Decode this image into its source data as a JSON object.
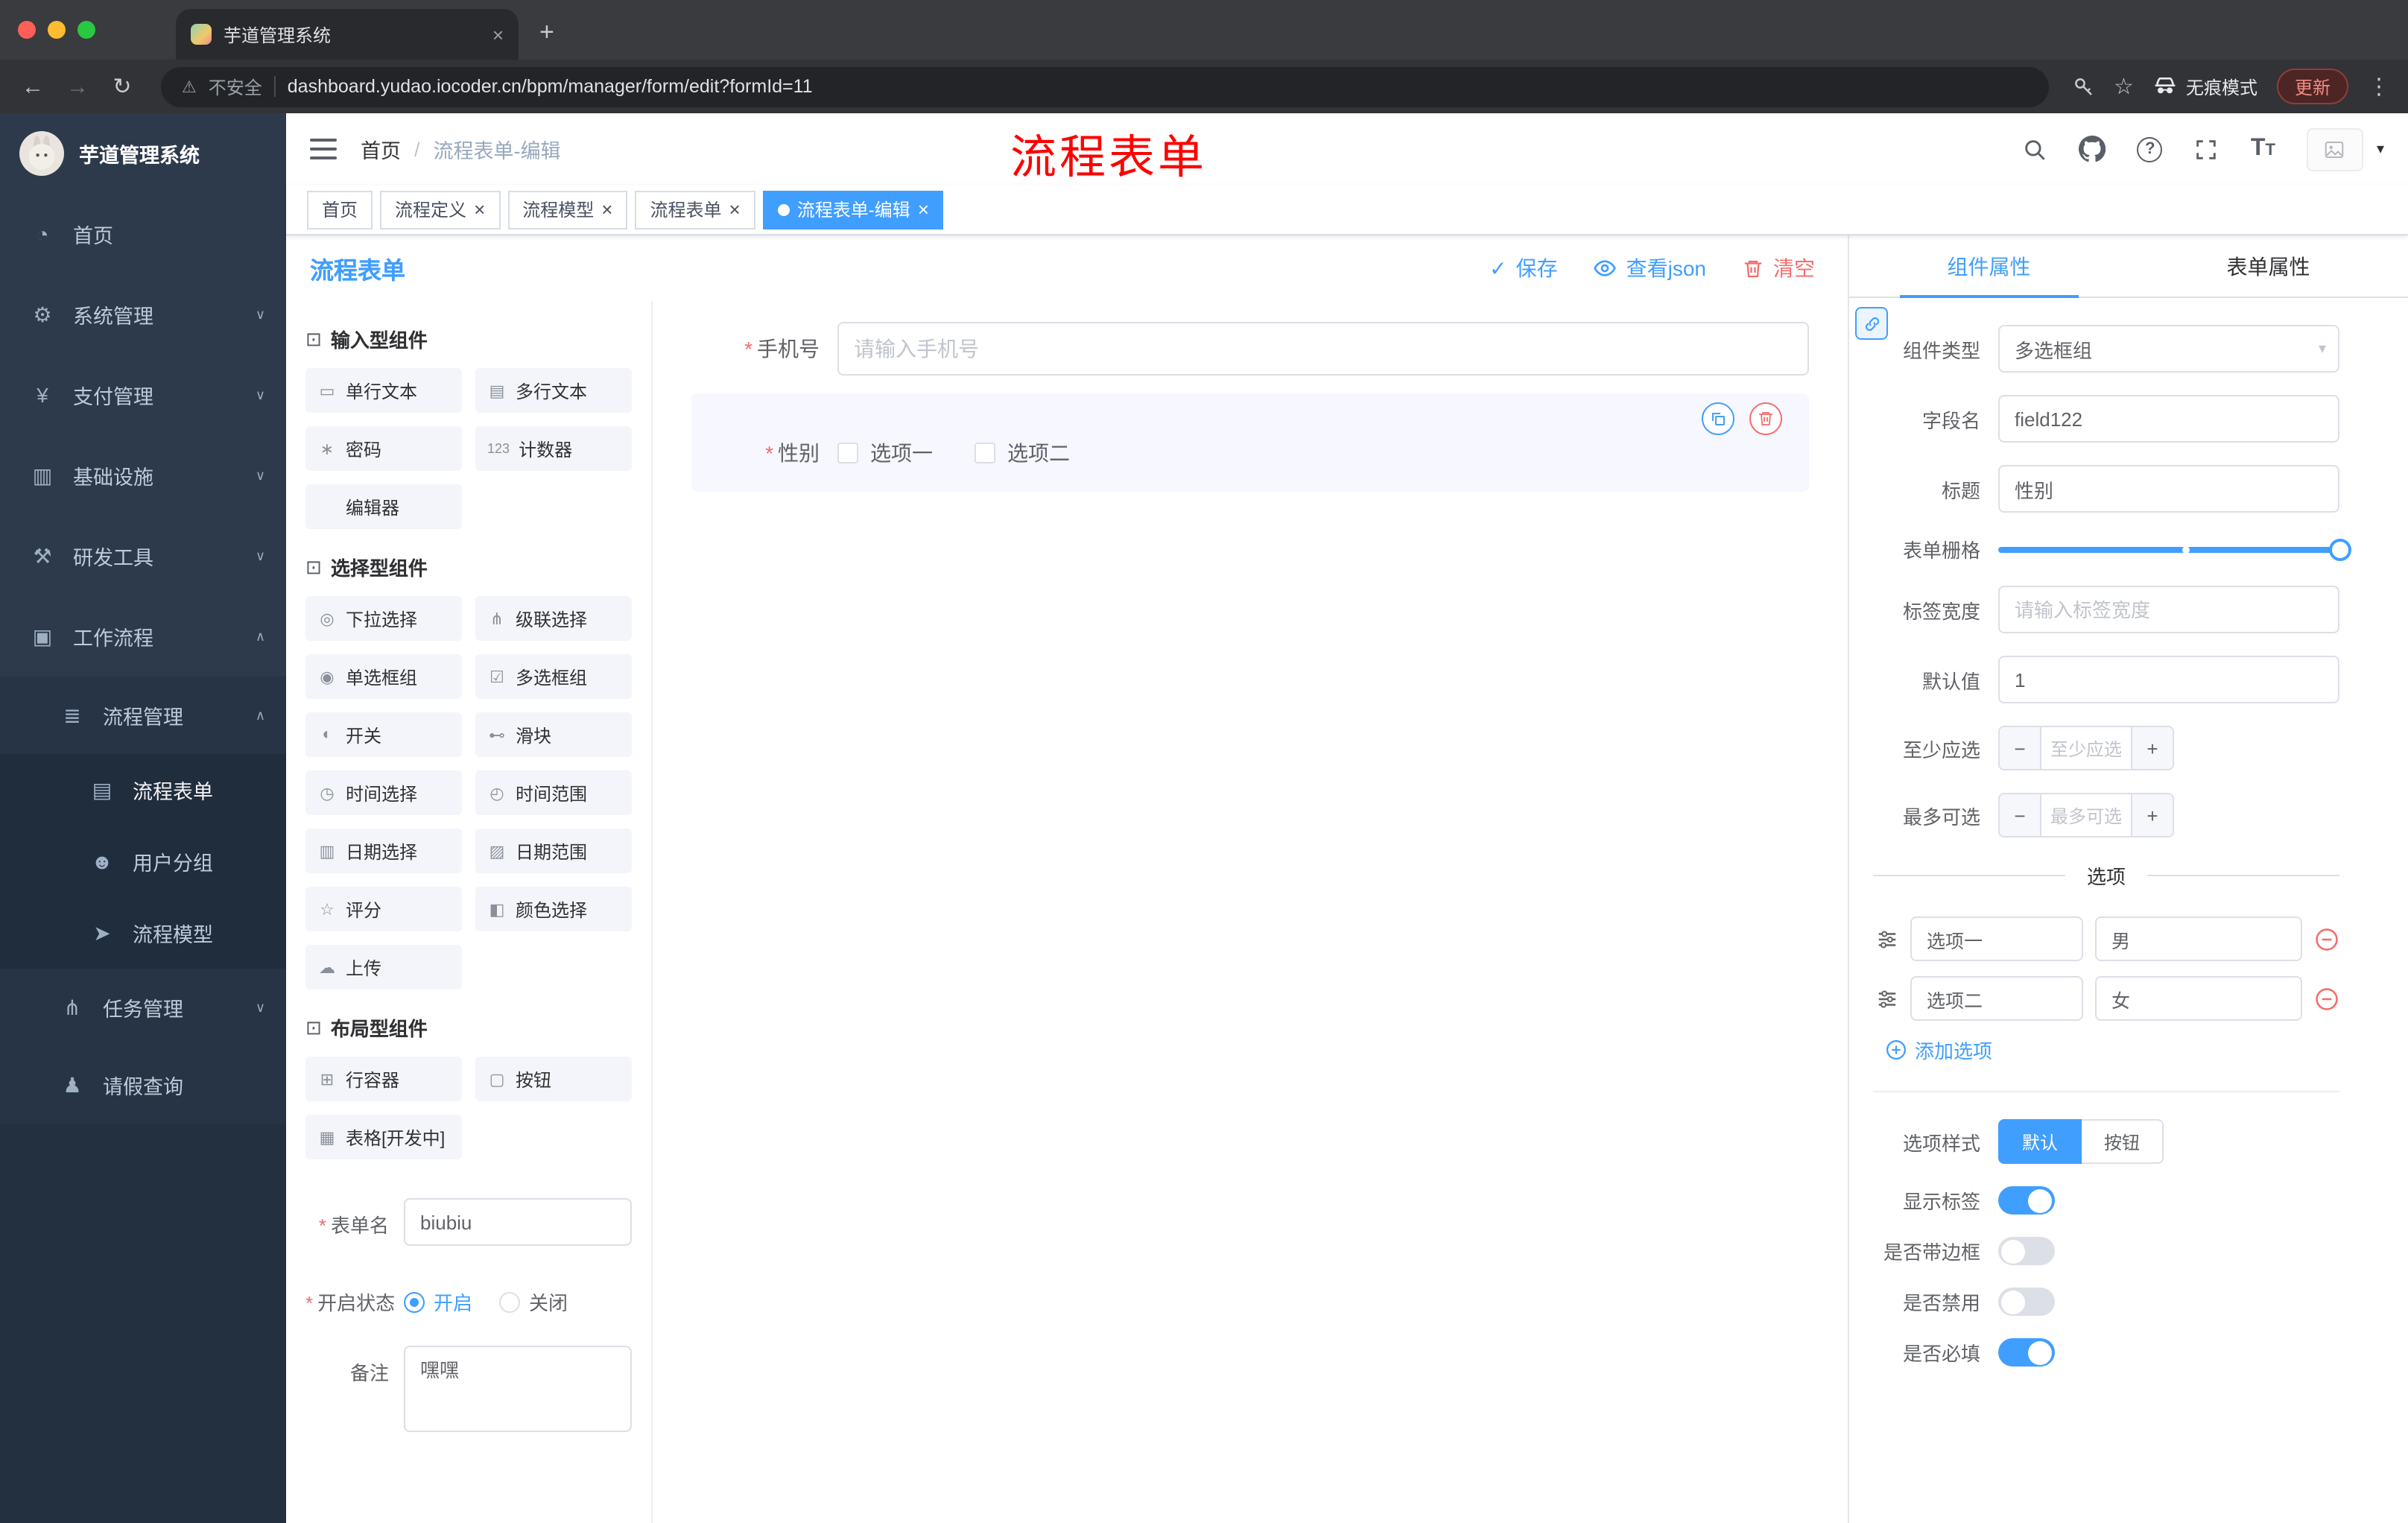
{
  "colors": {
    "primary": "#409eff",
    "danger": "#f56c6c",
    "sidebar_bg": "#2d3a4b",
    "active_tag": "#409eff",
    "annotation": "#ff0000"
  },
  "browser": {
    "tab_title": "芋道管理系统",
    "security": "不安全",
    "url": "dashboard.yudao.iocoder.cn/bpm/manager/form/edit?formId=11",
    "incognito": "无痕模式",
    "update": "更新",
    "glyphs": {
      "close": "×",
      "new_tab": "+",
      "back": "←",
      "forward": "→",
      "reload": "↻",
      "warn": "⚠",
      "star": "☆",
      "kebab": "⋮"
    }
  },
  "sidebar": {
    "app_title": "芋道管理系统",
    "items": [
      {
        "label": "首页",
        "icon": "◔",
        "arrow": ""
      },
      {
        "label": "系统管理",
        "icon": "⚙",
        "arrow": "∨"
      },
      {
        "label": "支付管理",
        "icon": "¥",
        "arrow": "∨"
      },
      {
        "label": "基础设施",
        "icon": "▥",
        "arrow": "∨"
      },
      {
        "label": "研发工具",
        "icon": "⚒",
        "arrow": "∨"
      },
      {
        "label": "工作流程",
        "icon": "▣",
        "arrow": "∧"
      },
      {
        "label": "流程管理",
        "icon": "≣",
        "arrow": "∧"
      },
      {
        "label": "流程表单",
        "icon": "▤",
        "arrow": ""
      },
      {
        "label": "用户分组",
        "icon": "☻",
        "arrow": ""
      },
      {
        "label": "流程模型",
        "icon": "➤",
        "arrow": ""
      },
      {
        "label": "任务管理",
        "icon": "⋔",
        "arrow": "∨"
      },
      {
        "label": "请假查询",
        "icon": "♟",
        "arrow": ""
      }
    ]
  },
  "header": {
    "breadcrumb_home": "首页",
    "breadcrumb_separator": "/",
    "breadcrumb_current": "流程表单-编辑",
    "annotation": "流程表单",
    "question_glyph": "?",
    "font_glyph": "T",
    "avatar_caret": "▾"
  },
  "tags": [
    {
      "label": "首页"
    },
    {
      "label": "流程定义"
    },
    {
      "label": "流程模型"
    },
    {
      "label": "流程表单"
    },
    {
      "label": "流程表单-编辑"
    }
  ],
  "tag_close_glyph": "×",
  "designer": {
    "title": "流程表单",
    "actions": {
      "save": "保存",
      "view_json": "查看json",
      "clear": "清空",
      "check_glyph": "✓"
    },
    "palette": {
      "sections": [
        {
          "title": "输入型组件",
          "icon": "⊡",
          "items": [
            {
              "label": "单行文本",
              "icon": "▭"
            },
            {
              "label": "多行文本",
              "icon": "▤"
            },
            {
              "label": "密码",
              "icon": "∗"
            },
            {
              "label": "计数器",
              "icon": "123"
            },
            {
              "label": "编辑器",
              "icon": ""
            }
          ]
        },
        {
          "title": "选择型组件",
          "icon": "⊡",
          "items": [
            {
              "label": "下拉选择",
              "icon": "◎"
            },
            {
              "label": "级联选择",
              "icon": "⋔"
            },
            {
              "label": "单选框组",
              "icon": "◉"
            },
            {
              "label": "多选框组",
              "icon": "☑"
            },
            {
              "label": "开关",
              "icon": "◐"
            },
            {
              "label": "滑块",
              "icon": "⊷"
            },
            {
              "label": "时间选择",
              "icon": "◷"
            },
            {
              "label": "时间范围",
              "icon": "◴"
            },
            {
              "label": "日期选择",
              "icon": "▥"
            },
            {
              "label": "日期范围",
              "icon": "▨"
            },
            {
              "label": "评分",
              "icon": "☆"
            },
            {
              "label": "颜色选择",
              "icon": "◧"
            },
            {
              "label": "上传",
              "icon": "☁"
            }
          ]
        },
        {
          "title": "布局型组件",
          "icon": "⊡",
          "items": [
            {
              "label": "行容器",
              "icon": "⊞"
            },
            {
              "label": "按钮",
              "icon": "▢"
            },
            {
              "label": "表格[开发中]",
              "icon": "▦"
            }
          ]
        }
      ],
      "form": {
        "name_label": "表单名",
        "name_value": "biubiu",
        "status_label": "开启状态",
        "status_on": "开启",
        "status_off": "关闭",
        "remark_label": "备注",
        "remark_value": "嘿嘿"
      }
    },
    "canvas": {
      "phone_label": "手机号",
      "phone_placeholder": "请输入手机号",
      "gender_label": "性别",
      "gender_options": [
        "选项一",
        "选项二"
      ]
    },
    "props": {
      "tab_component": "组件属性",
      "tab_form": "表单属性",
      "select_caret": "▾",
      "stepper_minus": "−",
      "stepper_plus": "+",
      "rows": {
        "type_label": "组件类型",
        "type_value": "多选框组",
        "field_label": "字段名",
        "field_value": "field122",
        "title_label": "标题",
        "title_value": "性别",
        "grid_label": "表单栅格",
        "width_label": "标签宽度",
        "width_placeholder": "请输入标签宽度",
        "default_label": "默认值",
        "default_value": "1",
        "min_label": "至少应选",
        "min_placeholder": "至少应选",
        "max_label": "最多可选",
        "max_placeholder": "最多可选",
        "options_title": "选项",
        "options": [
          {
            "label": "选项一",
            "value": "男"
          },
          {
            "label": "选项二",
            "value": "女"
          }
        ],
        "add_option": "添加选项",
        "style_label": "选项样式",
        "style_default": "默认",
        "style_button": "按钮",
        "show_label": "显示标签",
        "border_label": "是否带边框",
        "disabled_label": "是否禁用",
        "required_label": "是否必填"
      }
    }
  }
}
